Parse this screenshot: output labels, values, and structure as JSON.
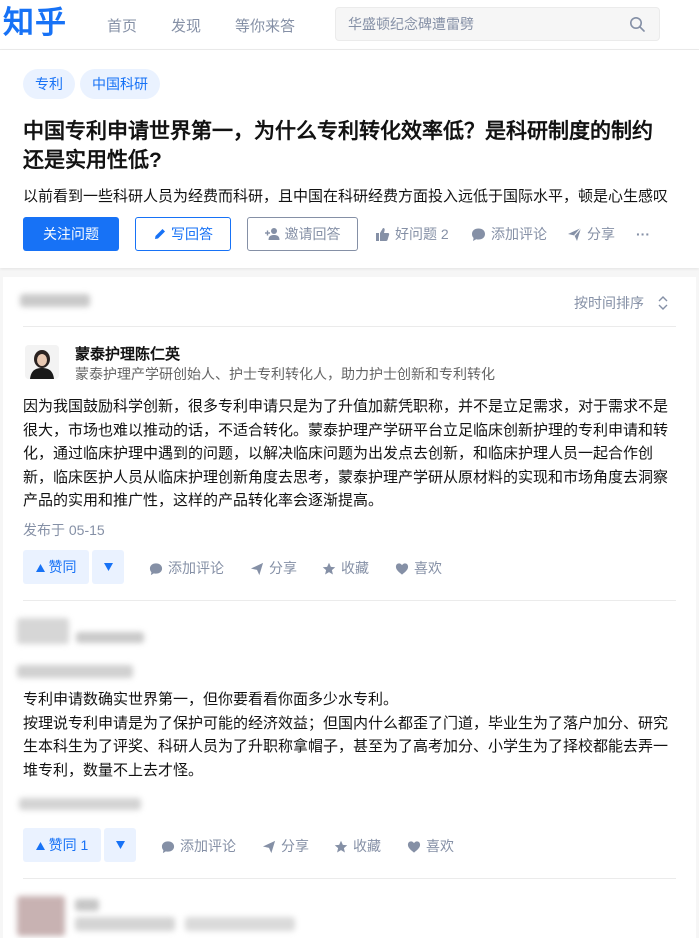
{
  "header": {
    "logo": "知乎",
    "nav": [
      "首页",
      "发现",
      "等你来答"
    ],
    "search_placeholder": "华盛顿纪念碑遭雷劈"
  },
  "question": {
    "tags": [
      "专利",
      "中国科研"
    ],
    "title_line1": "中国专利申请世界第一，为什么专利转化效率低？是科研制度的制约",
    "title_line2": "还是实用性低?",
    "detail": "以前看到一些科研人员为经费而科研，且中国在科研经费方面投入远低于国际水平，顿是心生感叹",
    "follow_label": "关注问题",
    "write_label": "写回答",
    "invite_label": "邀请回答",
    "good_question_label": "好问题 2",
    "comment_label": "添加评论",
    "share_label": "分享",
    "more_label": "···"
  },
  "answers_header": {
    "sort_label": "按时间排序"
  },
  "answer1": {
    "author_name": "蒙泰护理陈仁英",
    "author_desc": "蒙泰护理产学研创始人、护士专利转化人，助力护士创新和专利转化",
    "lines": [
      "因为我国鼓励科学创新，很多专利申请只是为了升值加薪凭职称，并不是立足需求，对于需求不是",
      "很大，市场也难以推动的话，不适合转化。蒙泰护理产学研平台立足临床创新护理的专利申请和转",
      "化，通过临床护理中遇到的问题，以解决临床问题为出发点去创新，和临床护理人员一起合作创",
      "新，临床医护人员从临床护理创新角度去思考，蒙泰护理产学研从原材料的实现和市场角度去洞察",
      "产品的实用和推广性，这样的产品转化率会逐渐提高。"
    ],
    "date": "发布于 05-15",
    "vote_label": "赞同",
    "comment_label": "添加评论",
    "share_label": "分享",
    "collect_label": "收藏",
    "like_label": "喜欢"
  },
  "answer2": {
    "lines": [
      "专利申请数确实世界第一，但你要看看你面多少水专利。",
      "按理说专利申请是为了保护可能的经济效益；但国内什么都歪了门道，毕业生为了落户加分、研究",
      "生本科生为了评奖、科研人员为了升职称拿帽子，甚至为了高考加分、小学生为了择校都能去弄一",
      "堆专利，数量不上去才怪。"
    ],
    "vote_label": "赞同 1",
    "comment_label": "添加评论",
    "share_label": "分享",
    "collect_label": "收藏",
    "like_label": "喜欢"
  },
  "colors": {
    "brand": "#1772f6",
    "muted": "#8590a6",
    "vote_bg": "#eaf2ff"
  },
  "icons": [
    "search-icon",
    "pencil-icon",
    "person-plus-icon",
    "thumbs-up-icon",
    "comment-icon",
    "share-icon",
    "star-icon",
    "heart-icon",
    "caret-up-icon",
    "caret-down-icon",
    "sort-icon"
  ]
}
